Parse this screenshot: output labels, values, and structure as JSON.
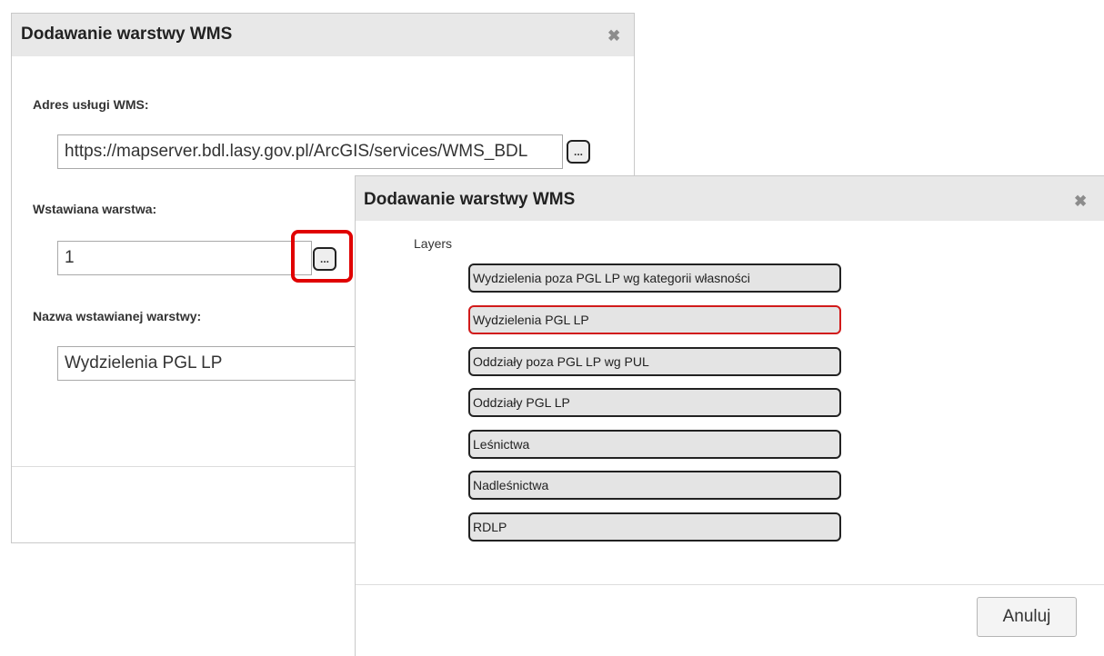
{
  "back_dialog": {
    "title": "Dodawanie warstwy WMS",
    "close_glyph": "✖",
    "url_label": "Adres usługi WMS:",
    "url_value": "https://mapserver.bdl.lasy.gov.pl/ArcGIS/services/WMS_BDL",
    "browse_label": "...",
    "layer_label": "Wstawiana warstwa:",
    "layer_value": "1",
    "layer_name_label": "Nazwa wstawianej warstwy:",
    "layer_name_value": "Wydzielenia PGL LP"
  },
  "front_dialog": {
    "title": "Dodawanie warstwy WMS",
    "close_glyph": "✖",
    "layers_caption": "Layers",
    "layers": [
      "Wydzielenia poza PGL LP wg kategorii własności",
      "Wydzielenia PGL LP",
      "Oddziały poza PGL LP wg PUL",
      "Oddziały PGL LP",
      "Leśnictwa",
      "Nadleśnictwa",
      "RDLP"
    ],
    "selected_layer": "Wydzielenia PGL LP",
    "cancel_label": "Anuluj"
  },
  "colors": {
    "highlight": "#e00000",
    "selected_border": "#d11a1a",
    "titlebar": "#e8e8e8"
  }
}
